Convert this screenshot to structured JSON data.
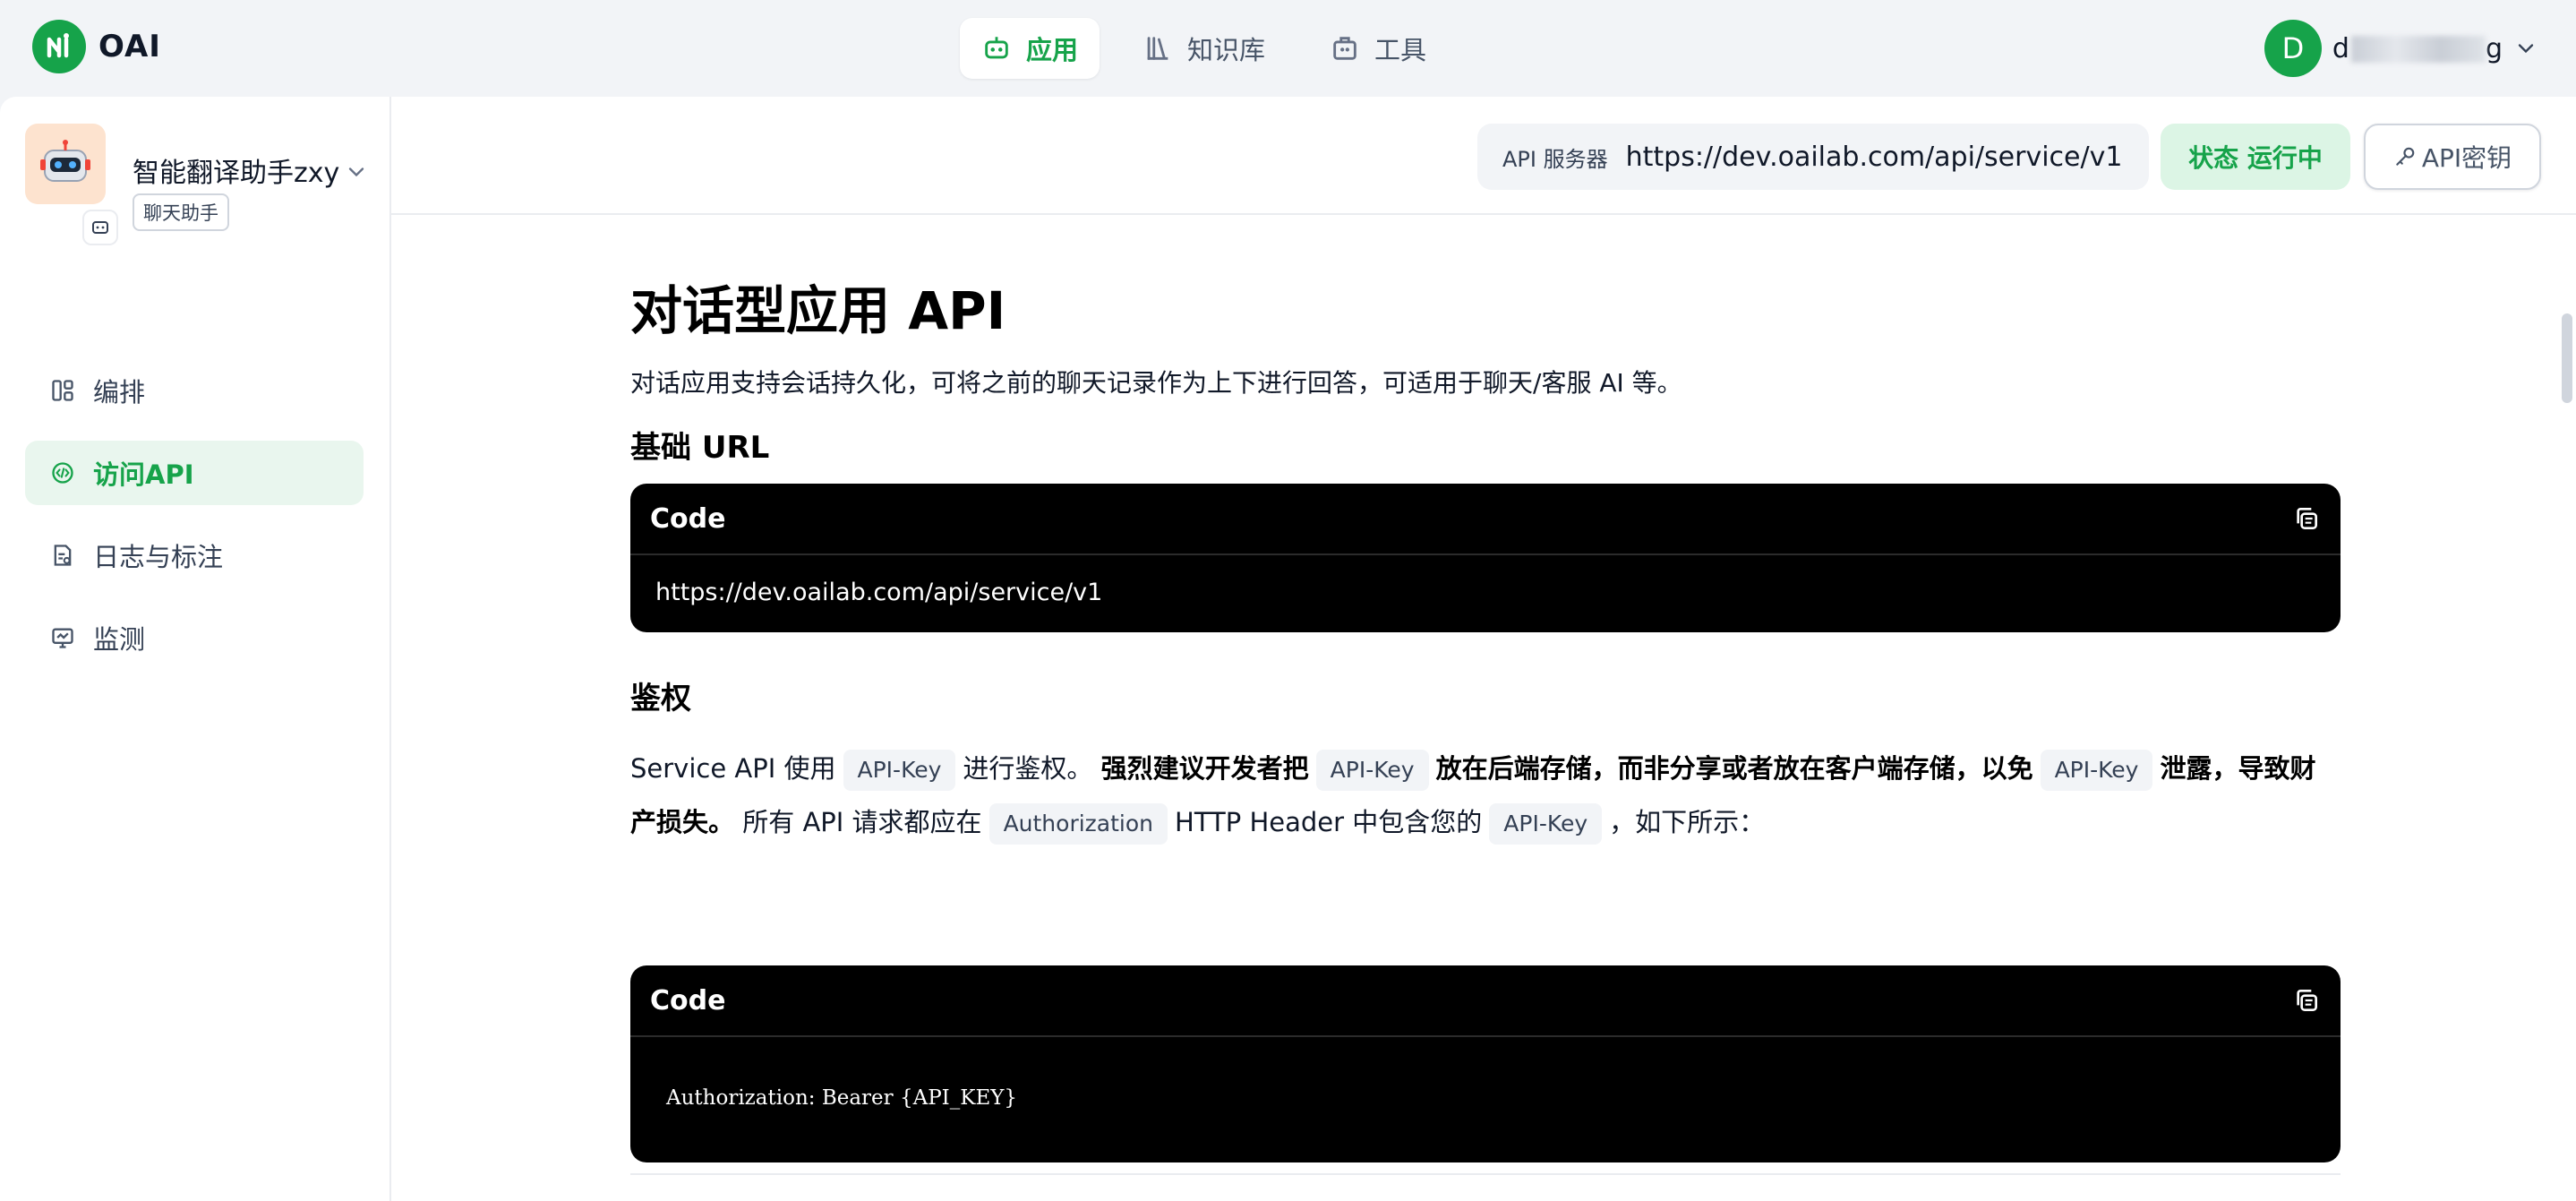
{
  "brand": {
    "name": "OAI",
    "accent": "#16a34a"
  },
  "nav": {
    "items": [
      {
        "label": "应用",
        "icon": "robot-icon",
        "active": true
      },
      {
        "label": "知识库",
        "icon": "books-icon",
        "active": false
      },
      {
        "label": "工具",
        "icon": "toolbox-icon",
        "active": false
      }
    ]
  },
  "user": {
    "initial": "D",
    "name_visible_start": "d",
    "name_visible_end": "g"
  },
  "app": {
    "name": "智能翻译助手zxy",
    "tag": "聊天助手"
  },
  "sidebar": {
    "items": [
      {
        "label": "编排",
        "icon": "layout-icon",
        "active": false
      },
      {
        "label": "访问API",
        "icon": "api-icon",
        "active": true
      },
      {
        "label": "日志与标注",
        "icon": "log-icon",
        "active": false
      },
      {
        "label": "监测",
        "icon": "monitor-icon",
        "active": false
      }
    ]
  },
  "header": {
    "api_server_label": "API 服务器",
    "api_server_url": "https://dev.oailab.com/api/service/v1",
    "status_label": "状态 运行中",
    "api_key_button": "API密钥"
  },
  "doc": {
    "title": "对话型应用 API",
    "intro": "对话应用支持会话持久化，可将之前的聊天记录作为上下进行回答，可适用于聊天/客服 AI 等。",
    "base_url_heading": "基础 URL",
    "base_url_code_label": "Code",
    "base_url_code": "https://dev.oailab.com/api/service/v1",
    "auth_heading": "鉴权",
    "auth_text": {
      "t1": "Service API 使用",
      "chip1": "API-Key",
      "t2": "进行鉴权。",
      "b1": "强烈建议开发者把",
      "chip2": "API-Key",
      "b2": "放在后端存储，而非分享或者放在客户端存储，以免",
      "chip3": "API-Key",
      "b3": "泄露，导致财产损失。",
      "t3": "所有 API 请求都应在",
      "chip4": "Authorization",
      "t4": "HTTP Header 中包含您的",
      "chip5": "API-Key",
      "t5": "，如下所示："
    },
    "auth_code_label": "Code",
    "auth_code": "Authorization: Bearer {API_KEY}"
  }
}
